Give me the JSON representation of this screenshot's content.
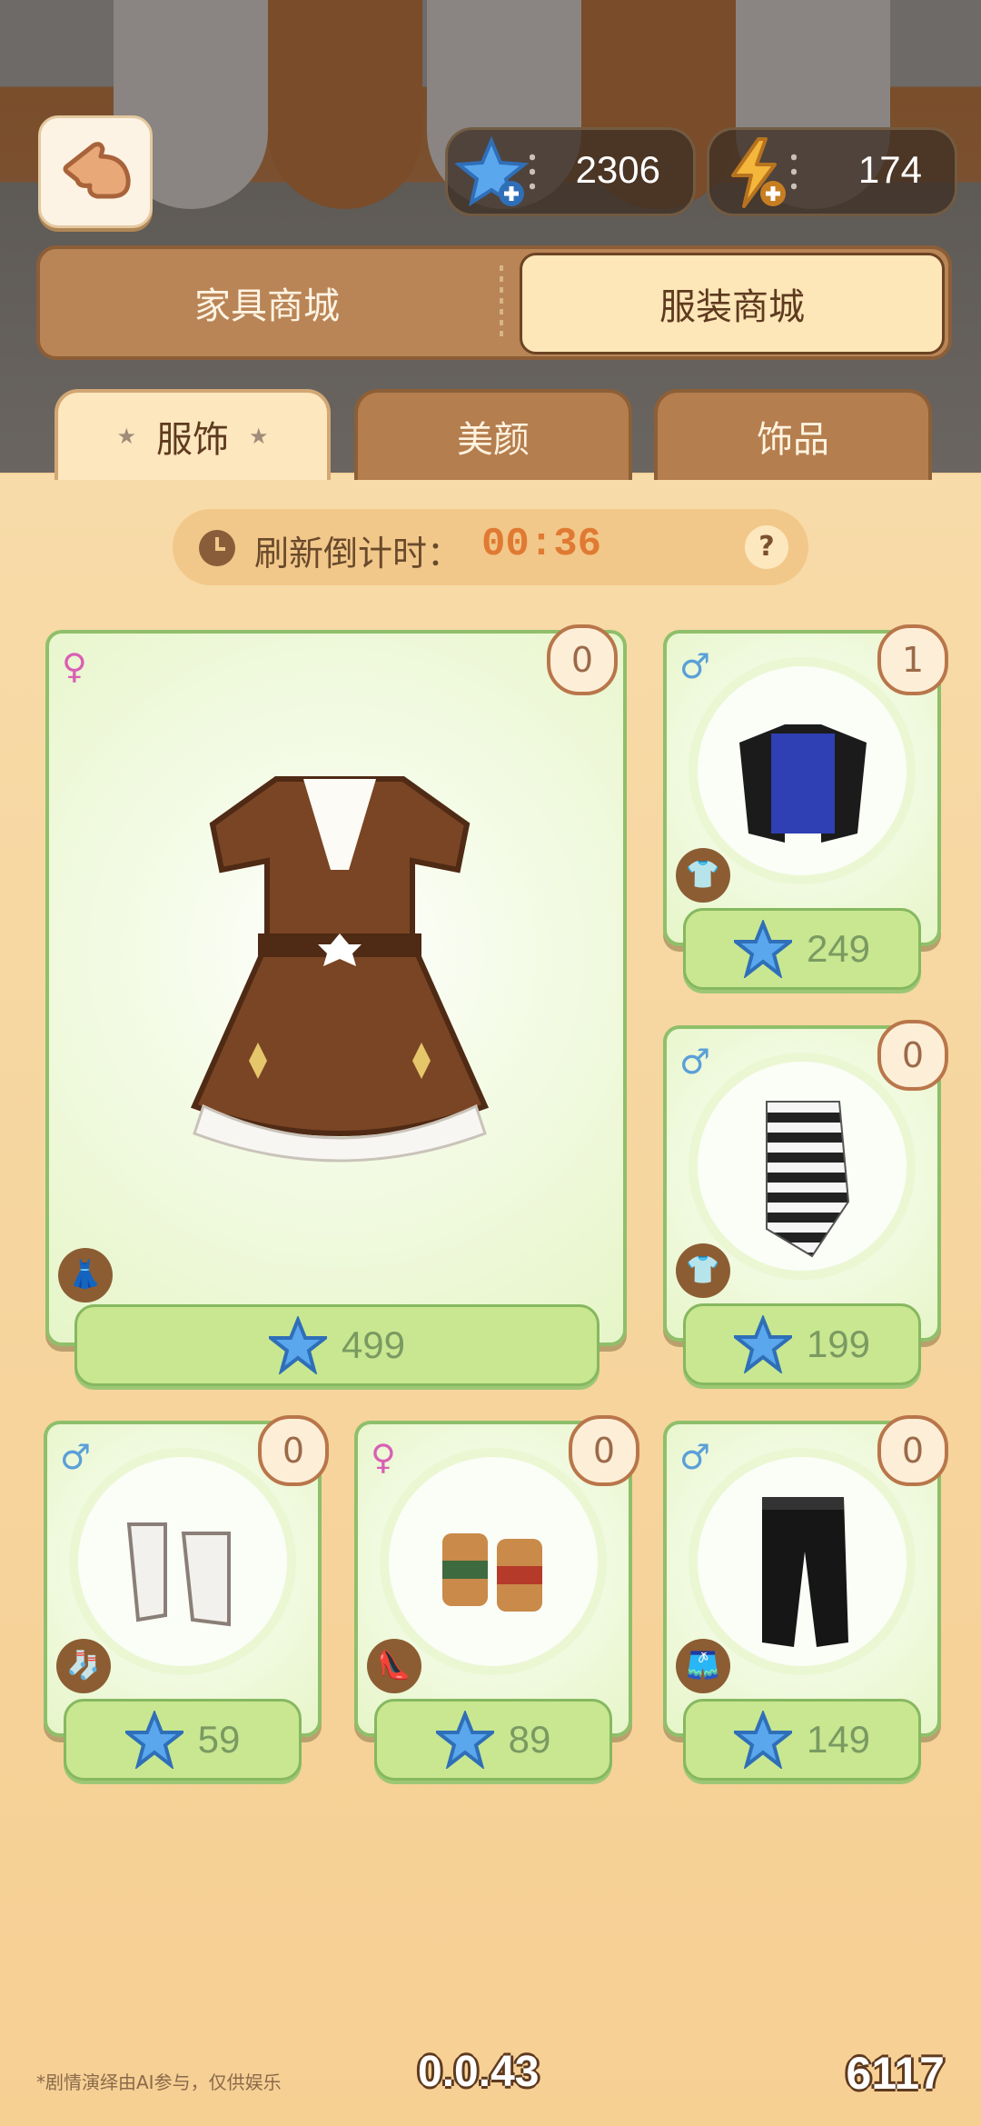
{
  "currency": {
    "gems": "2306",
    "energy": "174"
  },
  "main_tabs": {
    "furniture": "家具商城",
    "clothing": "服装商城"
  },
  "sub_tabs": {
    "apparel": "服饰",
    "beauty": "美颜",
    "accessories": "饰品"
  },
  "countdown": {
    "label": "刷新倒计时：",
    "time": "00:36",
    "help": "?"
  },
  "items": [
    {
      "name": "brown-dress",
      "owned": "0",
      "gender": "♀",
      "category": "dress",
      "price": "499"
    },
    {
      "name": "blue-jacket",
      "owned": "1",
      "gender": "♂",
      "category": "top",
      "price": "249"
    },
    {
      "name": "striped-top",
      "owned": "0",
      "gender": "♂",
      "category": "top",
      "price": "199"
    },
    {
      "name": "white-socks",
      "owned": "0",
      "gender": "♂",
      "category": "socks",
      "price": "59"
    },
    {
      "name": "sandals",
      "owned": "0",
      "gender": "♀",
      "category": "shoes",
      "price": "89"
    },
    {
      "name": "black-pants",
      "owned": "0",
      "gender": "♂",
      "category": "pants",
      "price": "149"
    }
  ],
  "footer": {
    "disclaimer": "*剧情演绎由AI参与，仅供娱乐",
    "version": "0.0.43",
    "uid": "6117"
  },
  "colors": {
    "accent_orange": "#e07a33",
    "card_border": "#8fbf6a",
    "tab_brown": "#b98556"
  }
}
